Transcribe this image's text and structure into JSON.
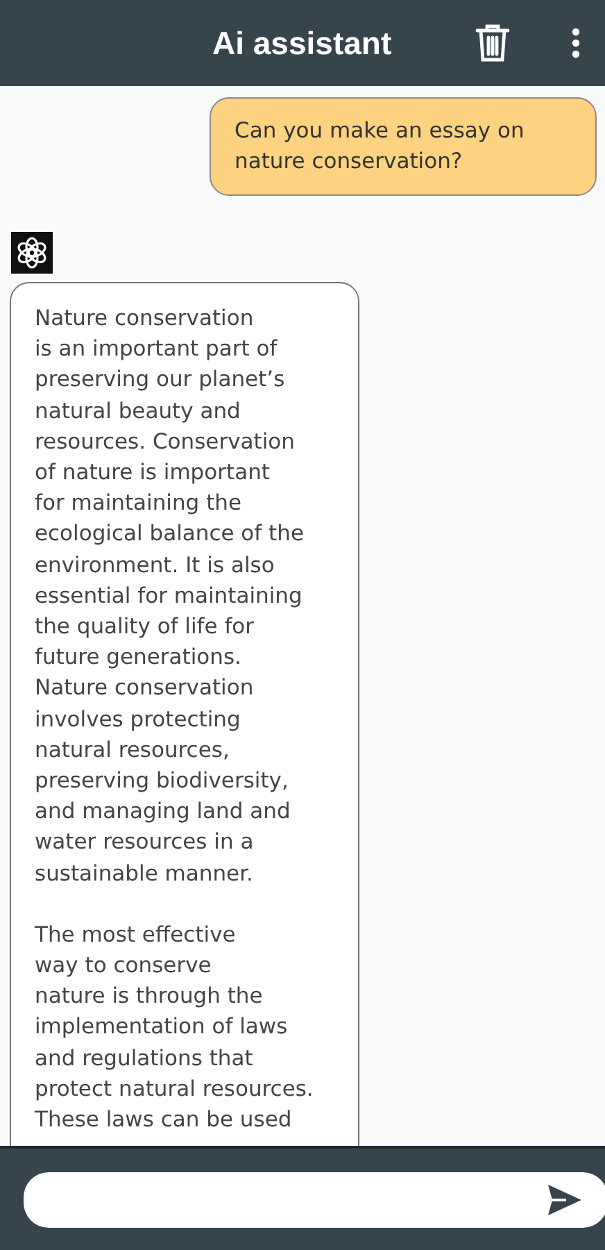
{
  "app_bar": {
    "title": "Ai assistant"
  },
  "messages": [
    {
      "kind": "user",
      "text": "Can you make an essay on nature conservation?"
    },
    {
      "kind": "assistant",
      "paragraphs": [
        [
          "Nature conservation",
          "is an important part of",
          "preserving our planet’s",
          "natural beauty and",
          "resources. Conservation",
          "of nature is important",
          "for maintaining the",
          "ecological balance of the",
          "environment. It is also",
          "essential for maintaining",
          "the quality of life for",
          "future generations.",
          "Nature conservation",
          "involves protecting",
          "natural resources,",
          "preserving biodiversity,",
          "and managing land and",
          "water resources in a",
          "sustainable manner."
        ],
        [
          "The most effective",
          "way to conserve",
          "nature is through the",
          "implementation of laws",
          "and regulations that",
          "protect natural resources.",
          "These laws can be used"
        ]
      ]
    }
  ]
}
